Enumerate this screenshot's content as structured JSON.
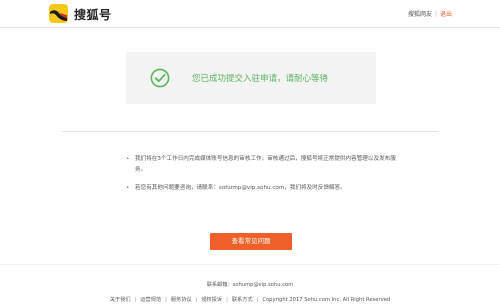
{
  "header": {
    "brand": "搜狐号",
    "user_link": "搜狐网友",
    "separator": "|",
    "logout": "退出"
  },
  "success": {
    "message": "您已成功提交入驻申请，请耐心等待"
  },
  "notes": [
    "我们将在3个工作日内完成媒体账号信息的审核工作。审核通过后，搜狐号将正常提供内容管理以及发布服务。",
    "若您有其他问题要咨询，请联系：sohump@vip.sohu.com，我们将及时反馈解答。"
  ],
  "note_bullet": "•",
  "faq_button": "查看常见问题",
  "footer": {
    "email": "联系邮箱：sohump@vip.sohu.com",
    "links": [
      "关于我们",
      "运营规范",
      "服务协议",
      "侵权投诉",
      "联系方式"
    ],
    "separator": "|",
    "copyright": "Copyright 2017 Sohu.com Inc. All Right Reserved"
  },
  "colors": {
    "accent": "#ee5f2a",
    "success": "#59b55c",
    "logo_bg": "#f6c81a"
  },
  "icons": {
    "logo": "sohu-fox-logo-icon",
    "status": "check-circle-icon"
  }
}
